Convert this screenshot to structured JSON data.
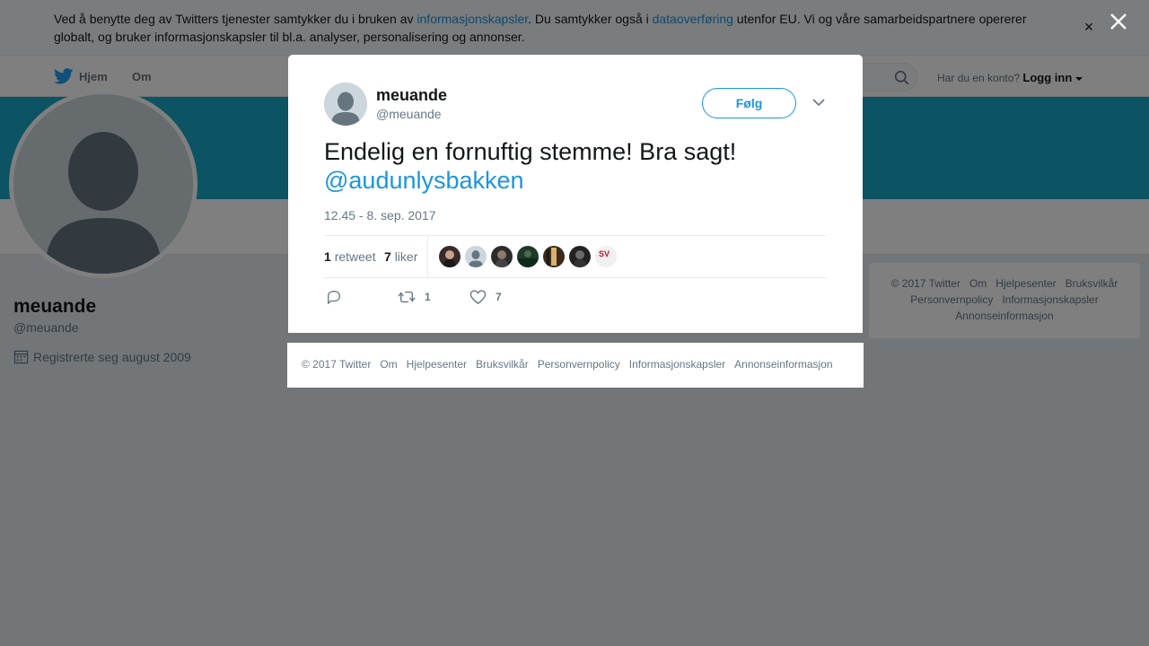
{
  "cookie_banner": {
    "text_1": "Ved å benytte deg av Twitters tjenester samtykker du i bruken av ",
    "link_1": "informasjonskapsler",
    "text_2": ". Du samtykker også i ",
    "link_2": "dataoverføring",
    "text_3": " utenfor EU. Vi og våre samarbeidspartnere opererer globalt, og bruker informasjonskapsler til bl.a. analyser, personalisering og annonser.",
    "close": "×"
  },
  "nav": {
    "home": "Hjem",
    "about": "Om",
    "login_prompt": "Har du en konto?",
    "login": "Logg inn"
  },
  "profile": {
    "name": "meuande",
    "handle": "@meuande",
    "joined": "Registrerte seg august 2009"
  },
  "right_footer": {
    "links": [
      "© 2017 Twitter",
      "Om",
      "Hjelpesenter",
      "Bruksvilkår",
      "Personvernpolicy",
      "Informasjonskapsler",
      "Annonseinformasjon"
    ]
  },
  "tweet": {
    "name": "meuande",
    "handle": "@meuande",
    "follow_label": "Følg",
    "text": "Endelig en fornuftig stemme! Bra sagt!",
    "mention": "@audunlysbakken",
    "timestamp": "12.45 - 8. sep. 2017",
    "retweets_count": "1",
    "retweets_label": "retweet",
    "likes_count": "7",
    "likes_label": "liker",
    "action_retweet_count": "1",
    "action_like_count": "7",
    "likers": [
      {
        "color": "#3a2a2a"
      },
      {
        "color": "#ccd6dd"
      },
      {
        "color": "#2b2b2b"
      },
      {
        "color": "#1f3a2a"
      },
      {
        "color": "#3b2a1a"
      },
      {
        "color": "#222222"
      },
      {
        "color": "#f0f0f0"
      }
    ],
    "last_liker_badge": "SV"
  },
  "modal_footer": {
    "links": [
      "© 2017 Twitter",
      "Om",
      "Hjelpesenter",
      "Bruksvilkår",
      "Personvernpolicy",
      "Informasjonskapsler",
      "Annonseinformasjon"
    ]
  },
  "colors": {
    "link": "#1b95e0",
    "banner": "#19a8c7",
    "overlay": "rgba(0,0,0,0.5)"
  }
}
